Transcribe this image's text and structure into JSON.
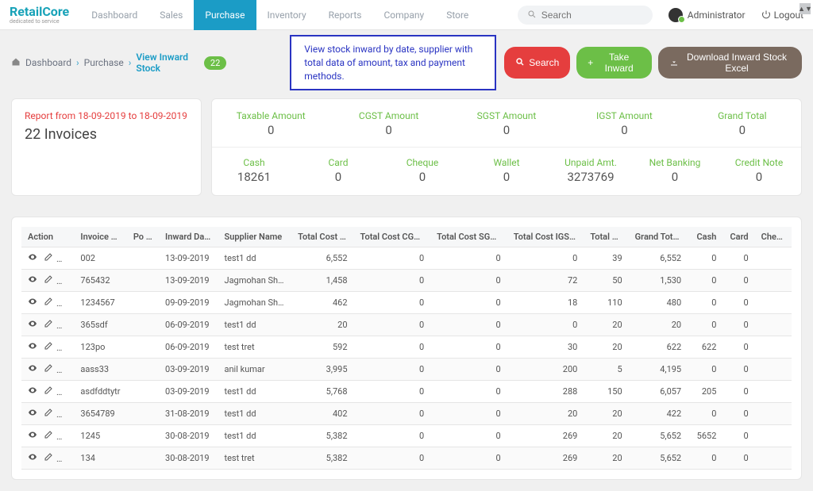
{
  "brand": {
    "name": "RetailCore",
    "tagline": "dedicated to service"
  },
  "nav": {
    "items": [
      "Dashboard",
      "Sales",
      "Purchase",
      "Inventory",
      "Reports",
      "Company",
      "Store"
    ],
    "active": "Purchase"
  },
  "search": {
    "placeholder": "Search"
  },
  "user": {
    "name": "Administrator"
  },
  "logout": "Logout",
  "breadcrumb": {
    "items": [
      "Dashboard",
      "Purchase",
      "View Inward Stock"
    ],
    "badge": "22"
  },
  "callout": "View stock inward by date, supplier with total data of amount, tax and payment methods.",
  "buttons": {
    "search": "Search",
    "take_inward": "Take Inward",
    "download": "Download Inward Stock Excel"
  },
  "report": {
    "range": "Report from 18-09-2019 to 18-09-2019",
    "invoices": "22 Invoices"
  },
  "totals_a": [
    {
      "label": "Taxable Amount",
      "val": "0"
    },
    {
      "label": "CGST Amount",
      "val": "0"
    },
    {
      "label": "SGST Amount",
      "val": "0"
    },
    {
      "label": "IGST Amount",
      "val": "0"
    },
    {
      "label": "Grand Total",
      "val": "0"
    }
  ],
  "totals_b": [
    {
      "label": "Cash",
      "val": "18261"
    },
    {
      "label": "Card",
      "val": "0"
    },
    {
      "label": "Cheque",
      "val": "0"
    },
    {
      "label": "Wallet",
      "val": "0"
    },
    {
      "label": "Unpaid Amt.",
      "val": "3273769"
    },
    {
      "label": "Net Banking",
      "val": "0"
    },
    {
      "label": "Credit Note",
      "val": "0"
    }
  ],
  "table": {
    "headers": [
      "Action",
      "Invoice No.",
      "Po No.",
      "Inward Date",
      "Supplier Name",
      "Total Cost Rate",
      "Total Cost CGST ₹",
      "Total Cost SGST ₹",
      "Total Cost IGST ₹",
      "Total Qty",
      "Grand Total ₹",
      "Cash",
      "Card",
      "Cheque"
    ],
    "rows": [
      {
        "inv": "002",
        "po": "",
        "date": "13-09-2019",
        "sup": "test1 dd",
        "rate": "6,552",
        "cgst": "0",
        "sgst": "0",
        "igst": "0",
        "qty": "39",
        "gt": "6,552",
        "cash": "0",
        "card": "0",
        "icon3": "delete"
      },
      {
        "inv": "765432",
        "po": "",
        "date": "13-09-2019",
        "sup": "Jagmohan Sheth",
        "rate": "1,458",
        "cgst": "0",
        "sgst": "0",
        "igst": "72",
        "qty": "50",
        "gt": "1,530",
        "cash": "0",
        "card": "0",
        "icon3": "delete"
      },
      {
        "inv": "1234567",
        "po": "",
        "date": "09-09-2019",
        "sup": "Jagmohan Sheth",
        "rate": "462",
        "cgst": "0",
        "sgst": "0",
        "igst": "18",
        "qty": "110",
        "gt": "480",
        "cash": "0",
        "card": "0",
        "icon3": "delete"
      },
      {
        "inv": "365sdf",
        "po": "",
        "date": "06-09-2019",
        "sup": "test1 dd",
        "rate": "20",
        "cgst": "0",
        "sgst": "0",
        "igst": "0",
        "qty": "20",
        "gt": "20",
        "cash": "0",
        "card": "0",
        "icon3": "delete"
      },
      {
        "inv": "123po",
        "po": "",
        "date": "06-09-2019",
        "sup": "test tret",
        "rate": "592",
        "cgst": "0",
        "sgst": "0",
        "igst": "30",
        "qty": "20",
        "gt": "622",
        "cash": "622",
        "card": "0",
        "icon3": "info"
      },
      {
        "inv": "aass33",
        "po": "",
        "date": "03-09-2019",
        "sup": "anil kumar",
        "rate": "3,995",
        "cgst": "0",
        "sgst": "0",
        "igst": "200",
        "qty": "5",
        "gt": "4,195",
        "cash": "0",
        "card": "0",
        "icon3": "delete"
      },
      {
        "inv": "asdfddtytr",
        "po": "",
        "date": "03-09-2019",
        "sup": "test1 dd",
        "rate": "5,768",
        "cgst": "0",
        "sgst": "0",
        "igst": "288",
        "qty": "150",
        "gt": "6,057",
        "cash": "205",
        "card": "0",
        "icon3": "delete"
      },
      {
        "inv": "3654789",
        "po": "",
        "date": "31-08-2019",
        "sup": "test1 dd",
        "rate": "402",
        "cgst": "0",
        "sgst": "0",
        "igst": "20",
        "qty": "20",
        "gt": "422",
        "cash": "0",
        "card": "0",
        "icon3": "delete"
      },
      {
        "inv": "1245",
        "po": "",
        "date": "30-08-2019",
        "sup": "test1 dd",
        "rate": "5,382",
        "cgst": "0",
        "sgst": "0",
        "igst": "269",
        "qty": "20",
        "gt": "5,652",
        "cash": "5652",
        "card": "0",
        "icon3": "delete"
      },
      {
        "inv": "134",
        "po": "",
        "date": "30-08-2019",
        "sup": "test tret",
        "rate": "5,382",
        "cgst": "0",
        "sgst": "0",
        "igst": "269",
        "qty": "20",
        "gt": "5,652",
        "cash": "0",
        "card": "0",
        "icon3": "delete"
      }
    ]
  }
}
